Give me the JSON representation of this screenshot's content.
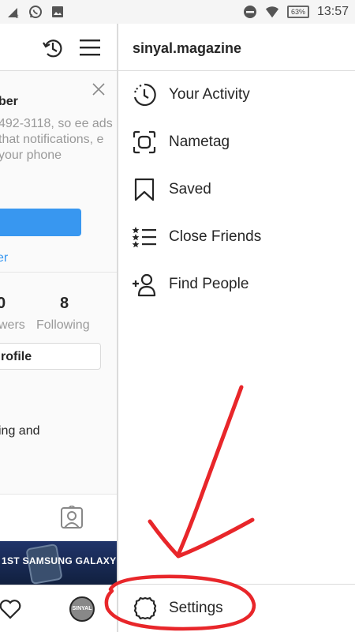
{
  "status_bar": {
    "battery": "63%",
    "time": "13:57"
  },
  "left_pane": {
    "card_title": "ber",
    "card_text": "492-3118, so ee ads that notifications, e your phone",
    "card_link": "er",
    "followers_count": "0",
    "followers_label": "wers",
    "following_count": "8",
    "following_label": "Following",
    "edit_profile_label": "rofile",
    "bio": "ing and",
    "post_text": "1ST SAMSUNG GALAXY",
    "avatar_text": "SINYAL"
  },
  "drawer": {
    "username": "sinyal.magazine",
    "items": [
      {
        "label": "Your Activity",
        "icon": "activity-clock-icon"
      },
      {
        "label": "Nametag",
        "icon": "nametag-icon"
      },
      {
        "label": "Saved",
        "icon": "bookmark-icon"
      },
      {
        "label": "Close Friends",
        "icon": "close-friends-list-icon"
      },
      {
        "label": "Find People",
        "icon": "add-person-icon"
      }
    ],
    "settings_label": "Settings"
  },
  "colors": {
    "accent_blue": "#3897f0",
    "annotation_red": "#e8262a"
  }
}
